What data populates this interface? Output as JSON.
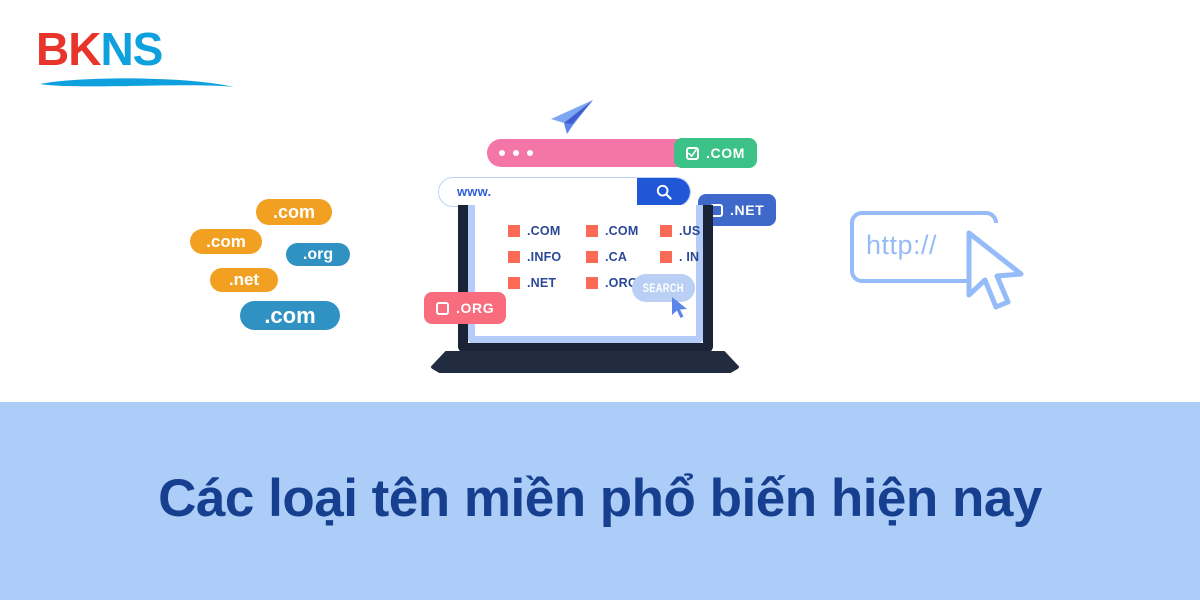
{
  "brand": {
    "name_part_red": "BK",
    "name_part_blue": "NS",
    "color_red": "#E8342A",
    "color_blue": "#0FA0DE"
  },
  "illustration": {
    "paper_plane_icon": "paper-plane-icon",
    "browser_window": {
      "dot_count": 3,
      "bar_color": "#F476A9"
    },
    "search_bar": {
      "value": "www.",
      "placeholder": "www.",
      "button_icon": "magnifier-icon",
      "button_color": "#1F57D6"
    },
    "badges": [
      {
        "label": ".COM",
        "checked": true,
        "color": "#3CC286",
        "name": "badge-com"
      },
      {
        "label": ".NET",
        "checked": false,
        "color": "#3E68C9",
        "name": "badge-net"
      },
      {
        "label": ".ORG",
        "checked": false,
        "color": "#F96C7E",
        "name": "badge-org"
      }
    ],
    "screen_tlds": [
      ".COM",
      ".COM",
      ".US",
      ".INFO",
      ".CA",
      ". IN",
      ".NET",
      ".ORG"
    ],
    "screen_search_button": "SEARCH",
    "floating_pills": [
      {
        "label": ".com",
        "color": "#F2A022"
      },
      {
        "label": ".com",
        "color": "#F2A022"
      },
      {
        "label": ".org",
        "color": "#2F92C2"
      },
      {
        "label": ".net",
        "color": "#F2A022"
      },
      {
        "label": ".com",
        "color": "#2F92C2"
      }
    ],
    "http_box": {
      "label": "http://",
      "color": "#95BBF8"
    },
    "cursor_icon": "mouse-pointer-icon"
  },
  "banner": {
    "title": "Các loại tên miền phổ biến hiện nay",
    "background_color": "#ACCDF7",
    "text_color": "#173F8F"
  }
}
